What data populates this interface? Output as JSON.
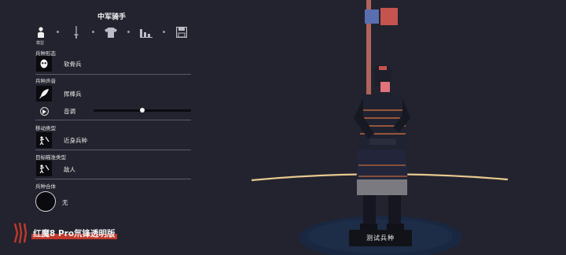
{
  "panel": {
    "title": "中军骑手",
    "tabs": [
      {
        "icon": "person-icon",
        "label": "模型",
        "selected": true
      },
      {
        "icon": "sword-icon",
        "label": ""
      },
      {
        "icon": "shirt-icon",
        "label": ""
      },
      {
        "icon": "bar-chart-icon",
        "label": ""
      },
      {
        "icon": "save-icon",
        "label": ""
      }
    ],
    "sections": {
      "form": {
        "label": "兵种形态",
        "value": "软骨兵",
        "icon": "skull-mask-icon"
      },
      "voice": {
        "label": "兵种声音",
        "value": "挥棒兵",
        "icon": "feather-icon",
        "pitch_label": "音调",
        "pitch": 0.5
      },
      "movement": {
        "label": "移动类型",
        "value": "近身兵种",
        "icon": "melee-icon"
      },
      "target": {
        "label": "目标瞄准类型",
        "value": "敌人",
        "icon": "target-melee-icon"
      },
      "combo": {
        "label": "兵种合体",
        "value": "无",
        "icon": "empty-circle-icon"
      }
    }
  },
  "test_button": "测试兵种",
  "watermark": "红魔8 Pro氘锋透明版",
  "colors": {
    "background": "#22232e",
    "flag_blue": "#5a6fb0",
    "flag_red": "#c5544f",
    "ground_line": "#e8c890"
  }
}
